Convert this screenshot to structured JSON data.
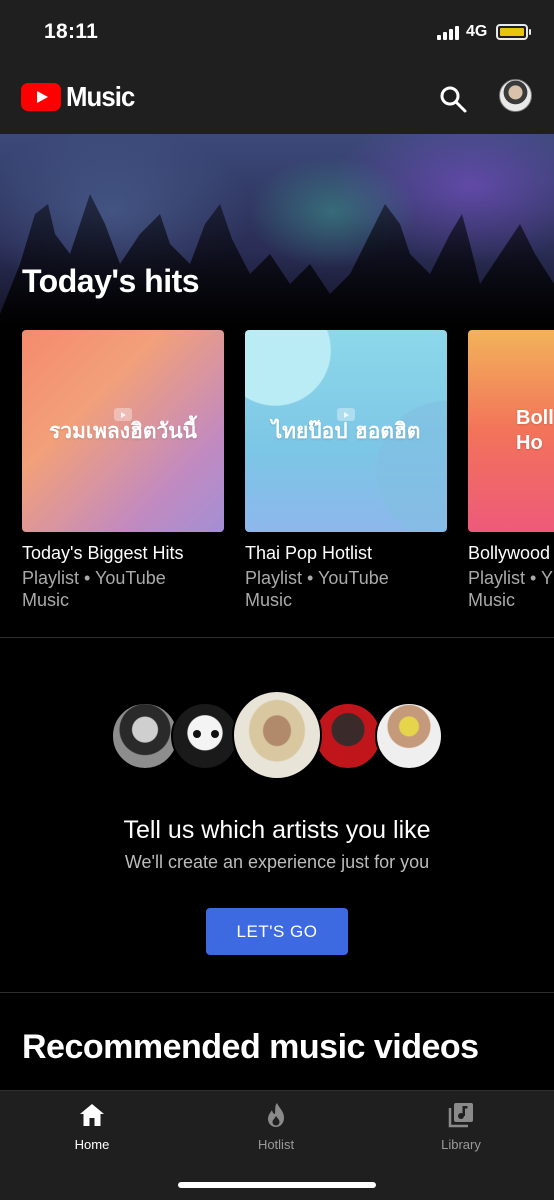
{
  "status_bar": {
    "time": "18:11",
    "network": "4G"
  },
  "header": {
    "logo_text": "Music"
  },
  "hero": {
    "section_title": "Today's hits",
    "playlists": [
      {
        "art_text": "รวมเพลงฮิตวันนี้",
        "title": "Today's Biggest Hits",
        "subtitle": "Playlist • YouTube Music"
      },
      {
        "art_text": "ไทยป๊อป ฮอตฮิต",
        "title": "Thai Pop Hotlist",
        "subtitle": "Playlist • YouTube Music"
      },
      {
        "art_text": "Boll\nHo",
        "title": "Bollywood",
        "subtitle": "Playlist • Y\nMusic"
      }
    ]
  },
  "artists_prompt": {
    "title": "Tell us which artists you like",
    "subtitle": "We'll create an experience just for you",
    "button_label": "LET'S GO"
  },
  "recommended": {
    "title": "Recommended music videos"
  },
  "bottom_nav": {
    "items": [
      {
        "label": "Home",
        "icon": "home-icon",
        "active": true
      },
      {
        "label": "Hotlist",
        "icon": "flame-icon",
        "active": false
      },
      {
        "label": "Library",
        "icon": "library-icon",
        "active": false
      }
    ]
  },
  "colors": {
    "brand_red": "#ff0000",
    "button_blue": "#3e6ae1",
    "battery": "#ffd60a"
  }
}
